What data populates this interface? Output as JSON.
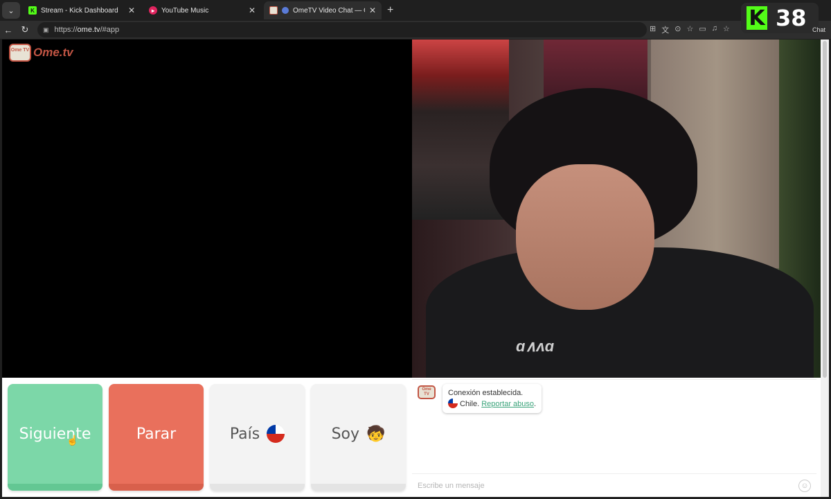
{
  "tabs": [
    {
      "title": "Stream - Kick Dashboard",
      "active": false,
      "favicon": "kick-icon"
    },
    {
      "title": "YouTube Music",
      "active": false,
      "favicon": "youtube-music-icon"
    },
    {
      "title": "OmeTV Video Chat — Omegl",
      "active": true,
      "favicon": "ometv-icon"
    }
  ],
  "address": {
    "scheme": "https://",
    "host": "ome.tv",
    "path": "/#app"
  },
  "overlay": {
    "viewer_count": "38",
    "chat_label": "Chat"
  },
  "logo": {
    "tv": "Ome TV",
    "word": "Ome.tv"
  },
  "buttons": {
    "next": "Siguiente",
    "stop": "Parar",
    "country": "País",
    "gender": "Soy"
  },
  "chat": {
    "logo_text": "Ome TV",
    "status": "Conexión establecida.",
    "country": "Chile.",
    "report_link": "Reportar abuso",
    "report_suffix": ".",
    "input_placeholder": "Escribe un mensaje"
  },
  "video_overlay": {
    "shirt_logo": "ɑ∧ʌɑ"
  },
  "colors": {
    "next": "#7cd7a8",
    "stop": "#e9705c",
    "neutral": "#f3f3f3",
    "kick": "#53fc18",
    "brand": "#c25544"
  }
}
